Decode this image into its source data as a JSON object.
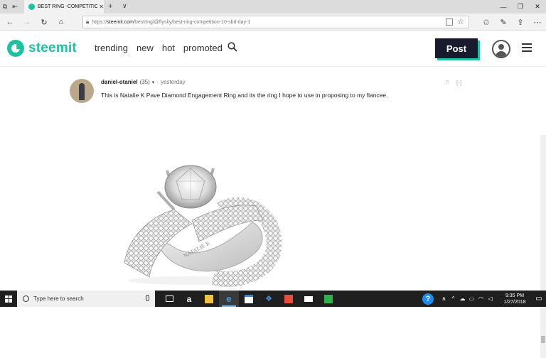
{
  "browser": {
    "tab_title": "BEST RING -COMPETITIO",
    "address_prefix": "https://",
    "address_domain": "steemit.com",
    "address_path": "/bestring/@flysky/best-ring-competition-10-sbd-day-1"
  },
  "header": {
    "logo_text": "steemit",
    "menu": [
      "trending",
      "new",
      "hot",
      "promoted"
    ],
    "post_label": "Post"
  },
  "comment": {
    "author": "daniel-otaniel",
    "reputation": "(35)",
    "separator": "·",
    "time": "yesterday",
    "text": "This is Natalie K Pave Diamond Engagement Ring and its the ring I hope to use in proposing to my fiancee.",
    "collapse_label": "[-]",
    "ring_engraving": "NATALIE K"
  },
  "taskbar": {
    "search_placeholder": "Type here to search",
    "help_label": "?",
    "time": "9:35 PM",
    "date": "1/27/2018"
  },
  "colors": {
    "brand": "#1bc3a0",
    "post_button": "#1a1a2e"
  }
}
